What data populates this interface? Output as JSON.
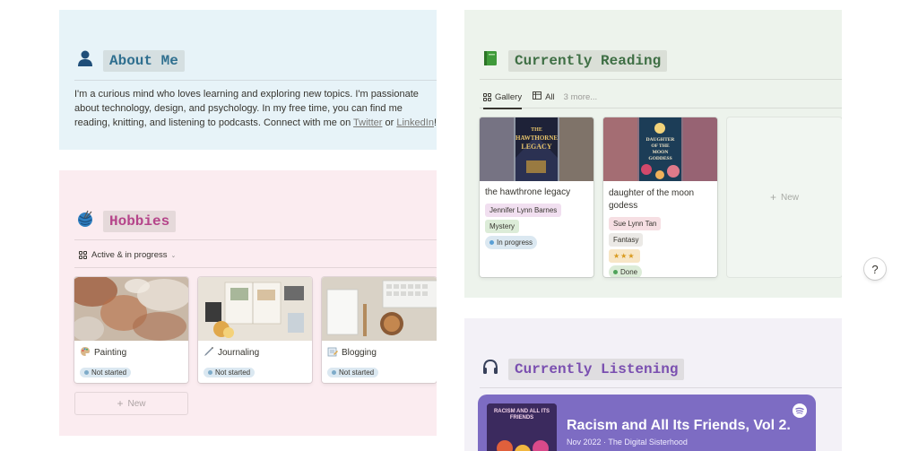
{
  "about": {
    "icon": "person-silhouette-icon",
    "title": "About Me",
    "text_before": "I'm a curious mind who loves learning and exploring new topics. I'm passionate about technology, design, and psychology. In my free time, you can find me reading, knitting, and listening to podcasts. Connect with me on ",
    "link_twitter": "Twitter",
    "text_or": " or ",
    "link_linkedin": "LinkedIn",
    "text_end": "!",
    "bg_color": "#e7f3f8",
    "title_color": "#2f6f8f"
  },
  "hobbies": {
    "icon": "yarn-ball-icon",
    "title": "Hobbies",
    "view_label": "Active & in progress",
    "bg_color": "#fbecf0",
    "title_color": "#b5458a",
    "cards": [
      {
        "icon": "palette-icon",
        "title": "Painting",
        "status": "Not started"
      },
      {
        "icon": "pen-icon",
        "title": "Journaling",
        "status": "Not started"
      },
      {
        "icon": "notepad-icon",
        "title": "Blogging",
        "status": "Not started"
      }
    ],
    "new_label": "New"
  },
  "reading": {
    "icon": "green-book-icon",
    "title": "Currently Reading",
    "tabs": [
      "Gallery",
      "All",
      "3 more..."
    ],
    "bg_color": "#edf3ec",
    "title_color": "#3f6f45",
    "books": [
      {
        "title": "the hawthrone legacy",
        "author": "Jennifer Lynn Barnes",
        "genre": "Mystery",
        "status": "In progress",
        "cover_lines": [
          "THE",
          "HAWTHORNE",
          "LEGACY"
        ]
      },
      {
        "title": "daughter of the moon godess",
        "author": "Sue Lynn Tan",
        "genre": "Fantasy",
        "rating": "★★★",
        "status": "Done",
        "cover_lines": [
          "DAUGHTER",
          "OF THE",
          "MOON",
          "GODDESS"
        ]
      }
    ],
    "new_label": "New"
  },
  "listening": {
    "icon": "headphones-icon",
    "title": "Currently Listening",
    "bg_color": "#f3f1f7",
    "title_color": "#7a4fb0",
    "podcast": {
      "title": "Racism and All Its Friends, Vol 2.",
      "subtitle": "Nov 2022 · The Digital Sisterhood",
      "cover_text": "RACISM AND ALL ITS FRIENDS",
      "logo": "spotify-icon"
    }
  },
  "help": {
    "label": "?"
  }
}
